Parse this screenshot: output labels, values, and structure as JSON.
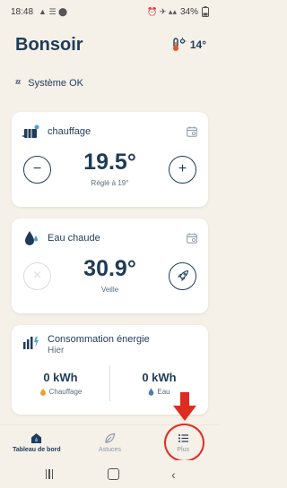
{
  "statusbar": {
    "time": "18:48",
    "battery": "34%"
  },
  "header": {
    "title": "Bonsoir",
    "outdoor_temp": "14°"
  },
  "system": {
    "status": "Système OK"
  },
  "heating": {
    "label": "chauffage",
    "temperature": "19.5°",
    "setpoint": "Réglé à 19°",
    "minus": "−",
    "plus": "+"
  },
  "hotwater": {
    "label": "Eau chaude",
    "temperature": "30.9°",
    "mode": "Veille",
    "off": "×"
  },
  "energy": {
    "title": "Consommation énergie",
    "period": "Hier",
    "heating_value": "0 kWh",
    "heating_label": "Chauffage",
    "water_value": "0 kWh",
    "water_label": "Eau"
  },
  "tabs": [
    {
      "label": "Tableau de bord"
    },
    {
      "label": "Astuces"
    },
    {
      "label": "Plus"
    }
  ],
  "colors": {
    "accent": "#1f3b57",
    "background": "#f5f0e8",
    "annotation": "#e02b20"
  }
}
